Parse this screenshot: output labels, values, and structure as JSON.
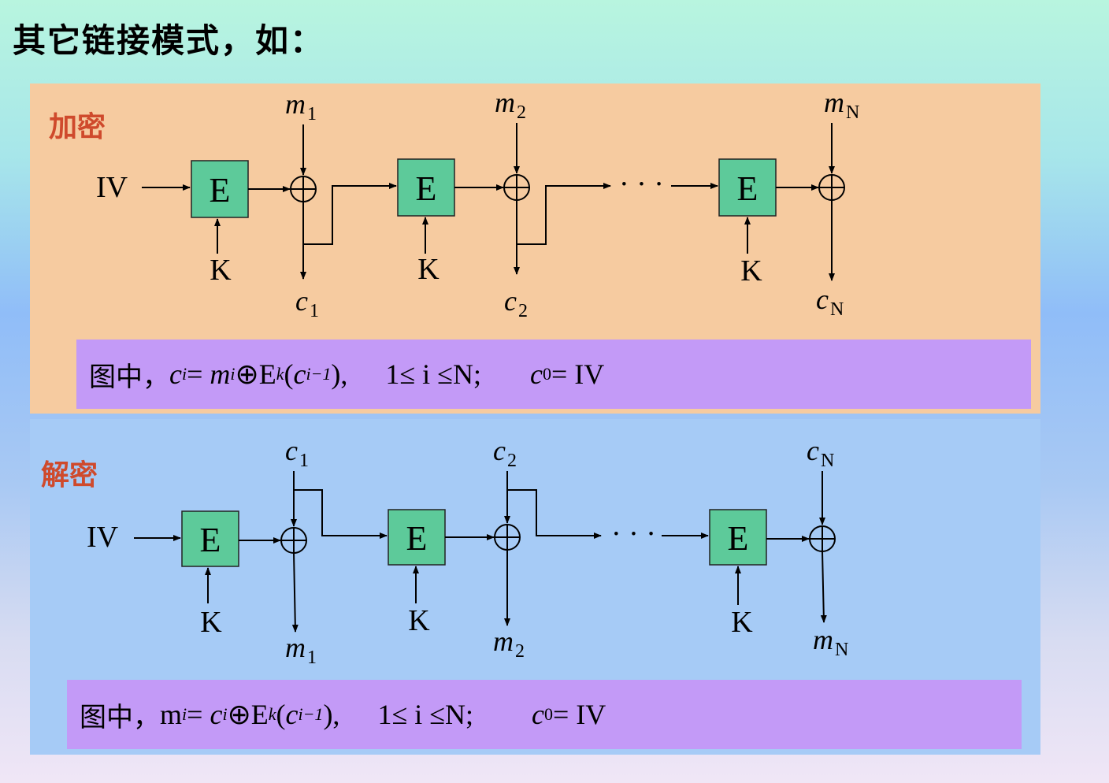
{
  "heading": "其它链接模式，如：",
  "colors": {
    "encrypt_panel": "#f6cba0",
    "decrypt_panel": "#a6cbf6",
    "formula_box": "#c39af7",
    "block": "#5dca9a",
    "label_red": "#cf4a2c"
  },
  "encrypt": {
    "label": "加密",
    "iv": "IV",
    "block_label": "E",
    "key_label": "K",
    "ellipsis": "· · ·",
    "inputs": [
      {
        "base": "m",
        "sub": "1"
      },
      {
        "base": "m",
        "sub": "2"
      },
      {
        "base": "m",
        "sub": "N"
      }
    ],
    "outputs": [
      {
        "base": "c",
        "sub": "1"
      },
      {
        "base": "c",
        "sub": "2"
      },
      {
        "base": "c",
        "sub": "N"
      }
    ],
    "formula": {
      "prefix": "图中，",
      "lhs": "c",
      "lhs_sub": "i",
      "op1": "= ",
      "term": "m",
      "term_sub": "i",
      "op2": "⊕E",
      "k_sub": "k",
      "paren_open": "(",
      "arg": "c",
      "arg_sub": "i−1",
      "paren_close": "),",
      "cond": "1≤ i ≤N;",
      "init": "c",
      "init_sub": "0",
      "init_rhs": "= IV"
    }
  },
  "decrypt": {
    "label": "解密",
    "iv": "IV",
    "block_label": "E",
    "key_label": "K",
    "ellipsis": "· · ·",
    "inputs": [
      {
        "base": "c",
        "sub": "1"
      },
      {
        "base": "c",
        "sub": "2"
      },
      {
        "base": "c",
        "sub": "N"
      }
    ],
    "outputs": [
      {
        "base": "m",
        "sub": "1"
      },
      {
        "base": "m",
        "sub": "2"
      },
      {
        "base": "m",
        "sub": "N"
      }
    ],
    "formula": {
      "prefix": "图中，",
      "lhs": "m",
      "lhs_sub": "i",
      "op1": "= ",
      "term": "c",
      "term_sub": "i",
      "op2": "⊕E",
      "k_sub": "k",
      "paren_open": "(",
      "arg": "c",
      "arg_sub": "i−1",
      "paren_close": "),",
      "cond": "1≤ i ≤N;",
      "init": "c",
      "init_sub": "0",
      "init_rhs": "= IV"
    }
  }
}
